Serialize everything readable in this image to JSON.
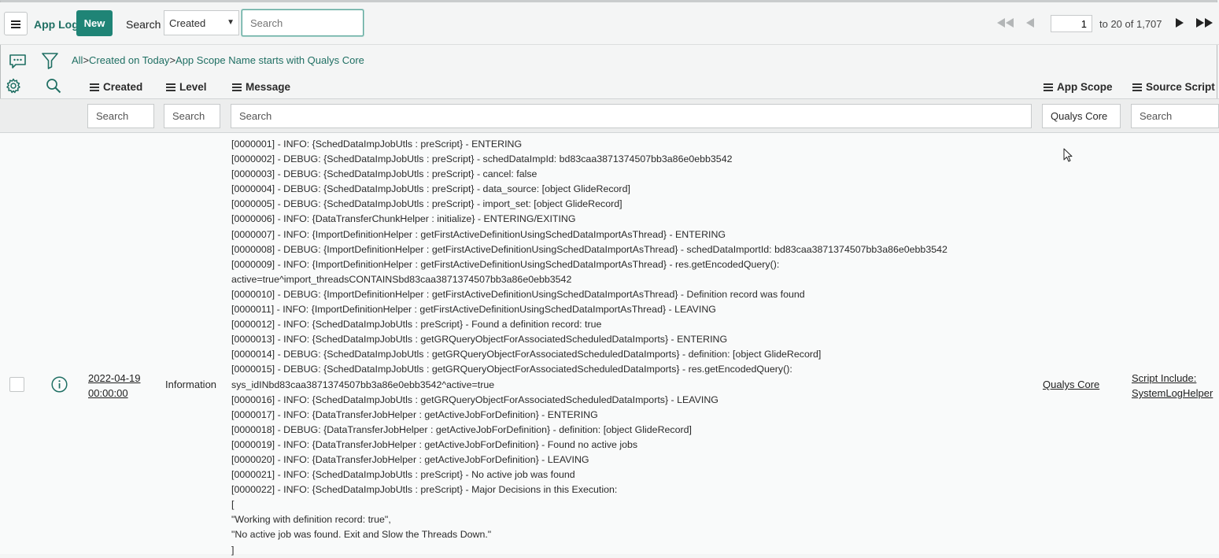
{
  "header": {
    "app_title": "App Log",
    "new_label": "New",
    "search_label": "Search",
    "search_field": "Created",
    "search_placeholder": "Search"
  },
  "pager": {
    "current": "1",
    "range_text": "to 20 of 1,707"
  },
  "breadcrumb": {
    "items": [
      "All",
      "Created on Today",
      "App Scope Name starts with Qualys Core"
    ],
    "separator": ">"
  },
  "columns": {
    "created": "Created",
    "level": "Level",
    "message": "Message",
    "app_scope": "App Scope",
    "source_script": "Source Script"
  },
  "column_filters": {
    "created": "Search",
    "level": "Search",
    "message": "Search",
    "app_scope": "Qualys Core",
    "source_script": "Search"
  },
  "row": {
    "created_date": "2022-04-19",
    "created_time": "00:00:00",
    "level": "Information",
    "app_scope": "Qualys Core",
    "source_script_line1": "Script Include:",
    "source_script_line2": "SystemLogHelper",
    "message_lines": [
      "[0000001] - INFO: {SchedDataImpJobUtls : preScript} - ENTERING",
      "[0000002] - DEBUG: {SchedDataImpJobUtls : preScript} - schedDataImpId: bd83caa3871374507bb3a86e0ebb3542",
      "[0000003] - DEBUG: {SchedDataImpJobUtls : preScript} - cancel: false",
      "[0000004] - DEBUG: {SchedDataImpJobUtls : preScript} - data_source: [object GlideRecord]",
      "[0000005] - DEBUG: {SchedDataImpJobUtls : preScript} - import_set: [object GlideRecord]",
      "[0000006] - INFO: {DataTransferChunkHelper : initialize} - ENTERING/EXITING",
      "[0000007] - INFO: {ImportDefinitionHelper : getFirstActiveDefinitionUsingSchedDataImportAsThread} - ENTERING",
      "[0000008] - DEBUG: {ImportDefinitionHelper : getFirstActiveDefinitionUsingSchedDataImportAsThread} - schedDataImportId: bd83caa3871374507bb3a86e0ebb3542",
      "[0000009] - INFO: {ImportDefinitionHelper : getFirstActiveDefinitionUsingSchedDataImportAsThread} - res.getEncodedQuery():",
      "active=true^import_threadsCONTAINSbd83caa3871374507bb3a86e0ebb3542",
      "[0000010] - DEBUG: {ImportDefinitionHelper : getFirstActiveDefinitionUsingSchedDataImportAsThread} - Definition record was found",
      "[0000011] - INFO: {ImportDefinitionHelper : getFirstActiveDefinitionUsingSchedDataImportAsThread} - LEAVING",
      "[0000012] - INFO: {SchedDataImpJobUtls : preScript} - Found a definition record: true",
      "[0000013] - INFO: {SchedDataImpJobUtls : getGRQueryObjectForAssociatedScheduledDataImports} - ENTERING",
      "[0000014] - DEBUG: {SchedDataImpJobUtls : getGRQueryObjectForAssociatedScheduledDataImports} - definition: [object GlideRecord]",
      "[0000015] - DEBUG: {SchedDataImpJobUtls : getGRQueryObjectForAssociatedScheduledDataImports} - res.getEncodedQuery():",
      "sys_idINbd83caa3871374507bb3a86e0ebb3542^active=true",
      "[0000016] - INFO: {SchedDataImpJobUtls : getGRQueryObjectForAssociatedScheduledDataImports} - LEAVING",
      "[0000017] - INFO: {DataTransferJobHelper : getActiveJobForDefinition} - ENTERING",
      "[0000018] - DEBUG: {DataTransferJobHelper : getActiveJobForDefinition} - definition: [object GlideRecord]",
      "[0000019] - INFO: {DataTransferJobHelper : getActiveJobForDefinition} - Found no active jobs",
      "[0000020] - INFO: {DataTransferJobHelper : getActiveJobForDefinition} - LEAVING",
      "[0000021] - INFO: {SchedDataImpJobUtls : preScript} - No active job was found",
      "[0000022] - INFO: {SchedDataImpJobUtls : preScript} - Major Decisions in this Execution:",
      "[",
      "\"Working with definition record: true\",",
      "\"No active job was found. Exit and Slow the Threads Down.\"",
      "]"
    ]
  },
  "icons": {
    "menu": "hamburger-icon",
    "pager_first": "first-page-icon",
    "pager_prev": "previous-page-icon",
    "pager_next": "next-page-icon",
    "pager_last": "last-page-icon",
    "activity": "chat-icon",
    "filter": "funnel-icon",
    "personalize": "gear-icon",
    "search": "magnifier-icon",
    "info": "info-icon"
  },
  "colors": {
    "accent": "#1f8476",
    "link": "#1f6f63"
  }
}
